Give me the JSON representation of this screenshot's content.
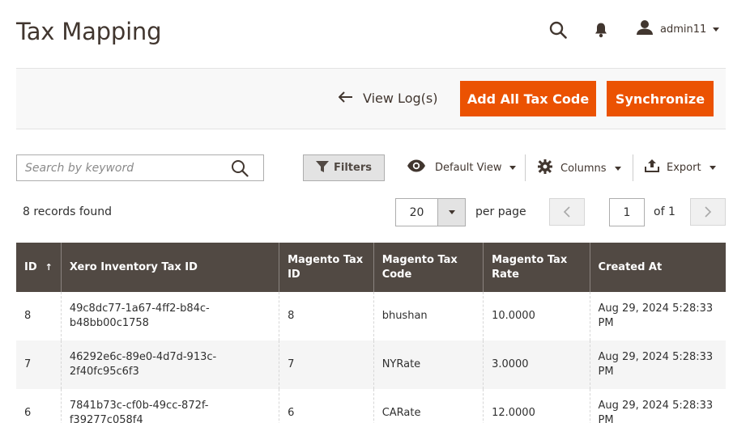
{
  "page": {
    "title": "Tax Mapping"
  },
  "header": {
    "search_icon": "search-icon",
    "bell_icon": "bell-icon",
    "user": {
      "name": "admin11",
      "icon": "user-icon"
    }
  },
  "actions": {
    "back_label": "View Log(s)",
    "add_all_label": "Add All Tax Code",
    "sync_label": "Synchronize",
    "accent_color": "#eb5202"
  },
  "toolbar": {
    "search_placeholder": "Search by keyword",
    "filters_label": "Filters",
    "view_label": "Default View",
    "columns_label": "Columns",
    "export_label": "Export"
  },
  "pagination": {
    "records_text": "8 records found",
    "per_page_value": "20",
    "per_page_label": "per page",
    "current_page": "1",
    "of_text": "of 1"
  },
  "table": {
    "header_color": "#514943",
    "columns": [
      "ID",
      "Xero Inventory Tax ID",
      "Magento Tax ID",
      "Magento Tax Code",
      "Magento Tax Rate",
      "Created At"
    ],
    "sort_indicator": "↑",
    "rows": [
      {
        "id": "8",
        "xero_id": "49c8dc77-1a67-4ff2-b84c-b48bb00c1758",
        "magento_tax_id": "8",
        "tax_code": "bhushan",
        "tax_rate": "10.0000",
        "created_at": "Aug 29, 2024 5:28:33 PM"
      },
      {
        "id": "7",
        "xero_id": "46292e6c-89e0-4d7d-913c-2f40fc95c6f3",
        "magento_tax_id": "7",
        "tax_code": "NYRate",
        "tax_rate": "3.0000",
        "created_at": "Aug 29, 2024 5:28:33 PM"
      },
      {
        "id": "6",
        "xero_id": "7841b73c-cf0b-49cc-872f-f39277c058f4",
        "magento_tax_id": "6",
        "tax_code": "CARate",
        "tax_rate": "12.0000",
        "created_at": "Aug 29, 2024 5:28:33 PM"
      }
    ]
  }
}
